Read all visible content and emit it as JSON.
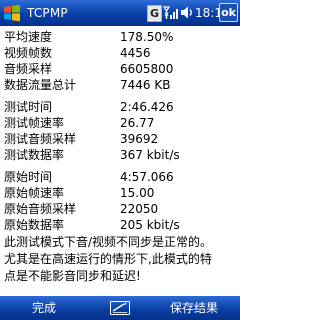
{
  "app": {
    "title": "TCPMP"
  },
  "status_bar": {
    "clock": "18:10",
    "ok_label": "ok",
    "g_label": "G"
  },
  "stats": {
    "general": [
      {
        "label": "平均速度",
        "value": "178.50%"
      },
      {
        "label": "视频帧数",
        "value": "4456"
      },
      {
        "label": "音频采样",
        "value": "6605800"
      },
      {
        "label": "数据流量总计",
        "value": "7446 KB"
      }
    ],
    "tested": [
      {
        "label": "测试时间",
        "value": "2:46.426"
      },
      {
        "label": "测试帧速率",
        "value": "26.77"
      },
      {
        "label": "测试音频采样",
        "value": "39692"
      },
      {
        "label": "测试数据率",
        "value": "367 kbit/s"
      }
    ],
    "original": [
      {
        "label": "原始时间",
        "value": "4:57.066"
      },
      {
        "label": "原始帧速率",
        "value": "15.00"
      },
      {
        "label": "原始音频采样",
        "value": "22050"
      },
      {
        "label": "原始数据率",
        "value": "205 kbit/s"
      }
    ]
  },
  "note": {
    "lines": [
      "此测试模式下音/视频不同步是正常的。",
      "尤其是在高速运行的情形下,此模式的特",
      "点是不能影音同步和延迟!"
    ]
  },
  "menu": {
    "left_label": "完成",
    "right_label": "保存结果"
  },
  "colors": {
    "bar_top": "#2d6bd6",
    "bar_bottom": "#06318a",
    "background": "#ffffff"
  }
}
